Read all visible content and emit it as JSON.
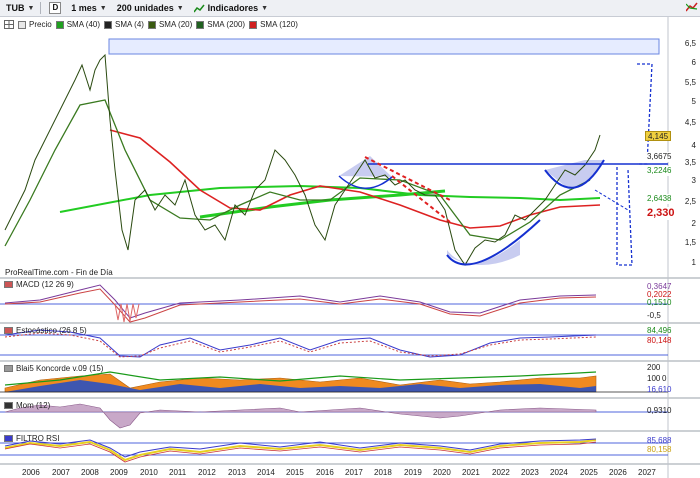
{
  "toolbar": {
    "symbol": "TUB",
    "d_box": "D",
    "period": "1 mes",
    "units": "200 unidades",
    "indicators": "Indicadores"
  },
  "legend": {
    "items": [
      {
        "label": "Precio",
        "color": "#e0e0e0"
      },
      {
        "label": "SMA (40)",
        "color": "#20a020"
      },
      {
        "label": "SMA (4)",
        "color": "#222222"
      },
      {
        "label": "SMA (20)",
        "color": "#3a5a10"
      },
      {
        "label": "SMA (200)",
        "color": "#206020"
      },
      {
        "label": "SMA (120)",
        "color": "#d02020"
      }
    ]
  },
  "y_axis_labels": [
    "6,5",
    "6",
    "5,5",
    "5",
    "4,5",
    "4",
    "3,5",
    "3",
    "2,5",
    "2",
    "1,5",
    "1"
  ],
  "price_tags": [
    {
      "text": "4,145",
      "bg": "#f0d040",
      "fg": "#000000"
    },
    {
      "text": "3,6675",
      "bg": "#ffffff",
      "fg": "#000000"
    },
    {
      "text": "3,2246",
      "bg": "#ffffff",
      "fg": "#1a8a1a"
    },
    {
      "text": "2,6438",
      "bg": "#ffffff",
      "fg": "#1a8a1a"
    },
    {
      "text": "2,330",
      "bg": "#ffffff",
      "fg": "#cc1111"
    }
  ],
  "source": "ProRealTime.com - Fin de Día",
  "panels": [
    {
      "title": "MACD (12 26 9)",
      "labels": [
        "0,3647",
        "0,2022",
        "0,1510",
        "-0,5"
      ]
    },
    {
      "title": "Estocástico (26 8 5)",
      "labels": [
        "84,496",
        "80,148"
      ]
    },
    {
      "title": "Blai5 Koncorde v.09 (15)",
      "labels": [
        "200",
        "100",
        "0",
        "16,610"
      ]
    },
    {
      "title": "Mom (12)",
      "labels": [
        "0,9310"
      ]
    },
    {
      "title": "FILTRO RSI",
      "labels": [
        "85,688",
        "80,158"
      ]
    }
  ],
  "x_axis": [
    "2006",
    "2007",
    "2008",
    "2009",
    "2010",
    "2011",
    "2012",
    "2013",
    "2014",
    "2015",
    "2016",
    "2017",
    "2018",
    "2019",
    "2020",
    "2021",
    "2022",
    "2023",
    "2024",
    "2025",
    "2026",
    "2027"
  ],
  "colors": {
    "accent": "#1530d0",
    "sma200": "#22cc22",
    "sma120": "#dd2222",
    "bull": "#1a9a1a",
    "bear": "#cc1111"
  }
}
